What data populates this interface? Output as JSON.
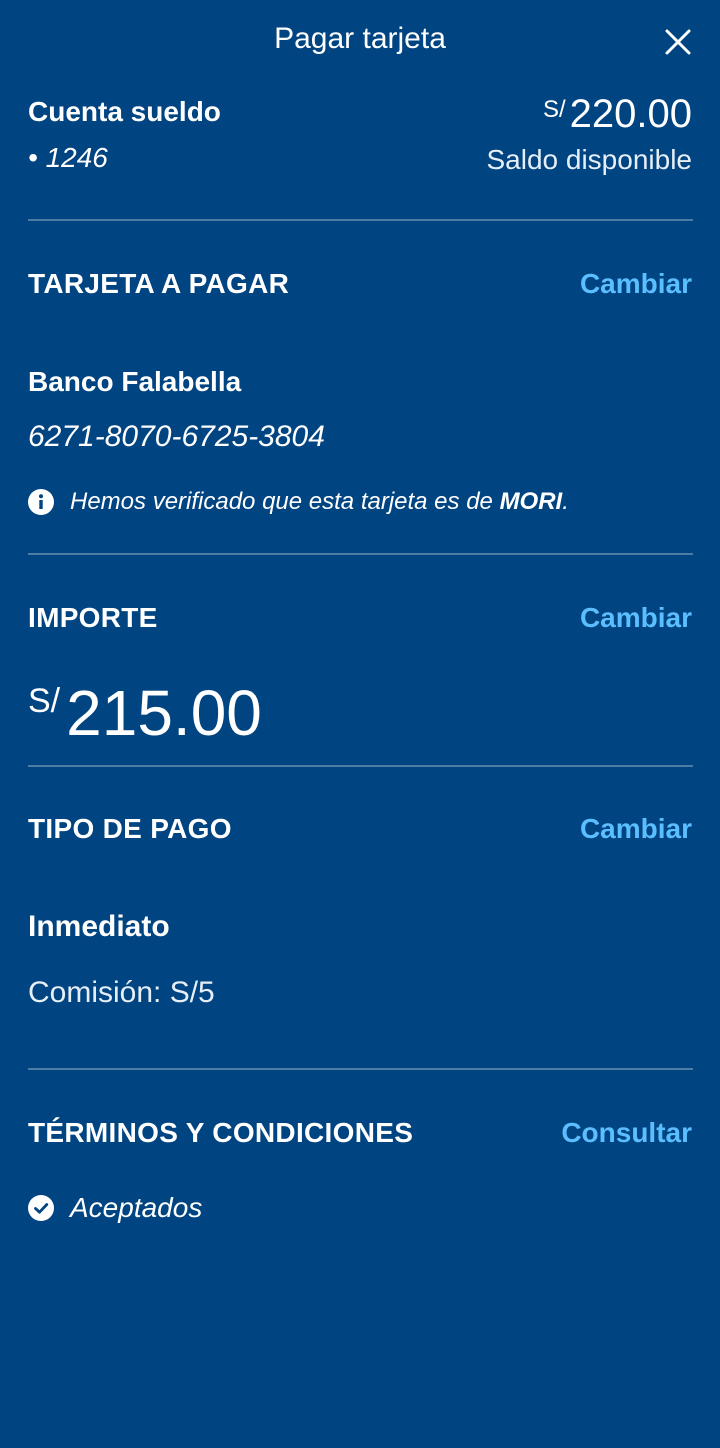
{
  "header": {
    "title": "Pagar tarjeta"
  },
  "account": {
    "name": "Cuenta sueldo",
    "number": "• 1246",
    "currency": "S/",
    "balance": "220.00",
    "balance_label": "Saldo disponible"
  },
  "card_section": {
    "title": "TARJETA A PAGAR",
    "change": "Cambiar",
    "bank": "Banco Falabella",
    "card_number": "6271-8070-6725-3804",
    "verify_text": "Hemos verificado que esta tarjeta es de ",
    "verify_name": "MORI",
    "verify_end": "."
  },
  "amount_section": {
    "title": "IMPORTE",
    "change": "Cambiar",
    "currency": "S/",
    "amount": "215.00"
  },
  "payment_section": {
    "title": "TIPO DE PAGO",
    "change": "Cambiar",
    "type": "Inmediato",
    "fee": "Comisión: S/5"
  },
  "terms_section": {
    "title": "TÉRMINOS Y CONDICIONES",
    "link": "Consultar",
    "status": "Aceptados"
  },
  "colors": {
    "background": "#004481",
    "link": "#5bbeff"
  },
  "icons": {
    "close": "close-icon",
    "info": "info-icon",
    "check": "check-circle-icon"
  }
}
